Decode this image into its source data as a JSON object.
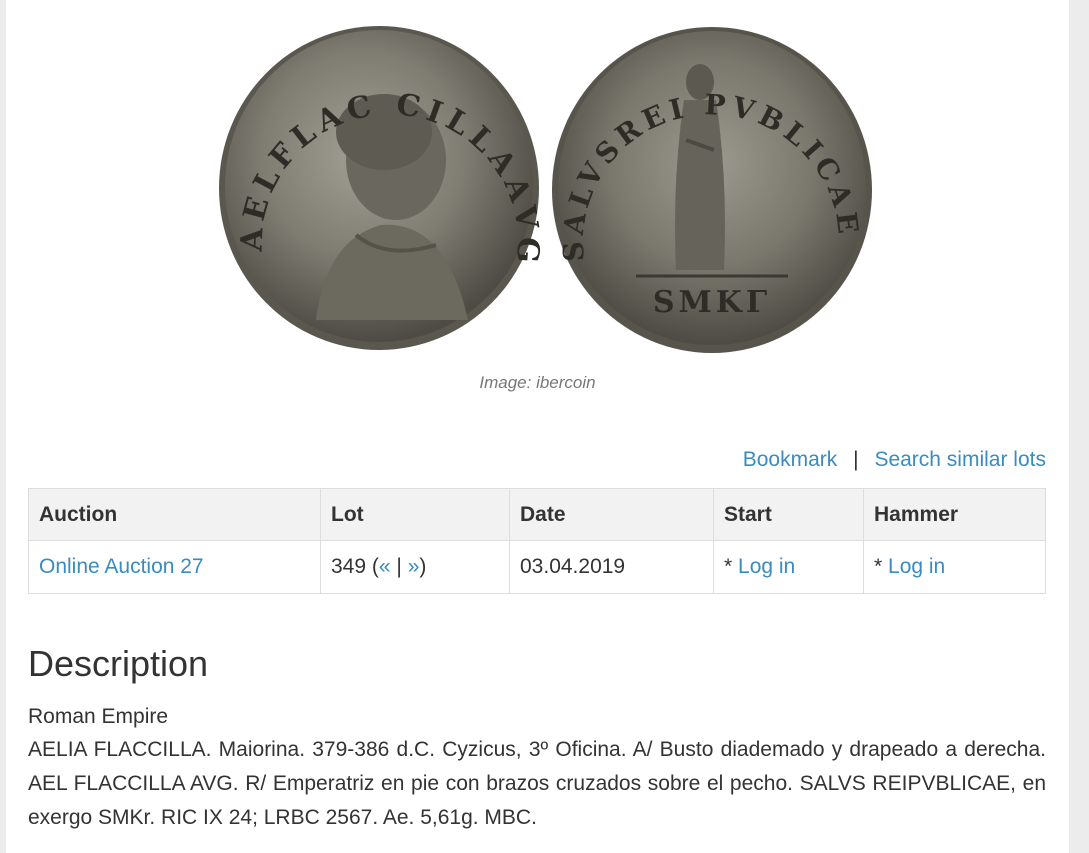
{
  "figure": {
    "alt": "Coin obverse and reverse",
    "credit": "Image: ibercoin",
    "obverse_legend": "AELFLAC CILLAAVG",
    "reverse_legend": "SALVSREI PVBLICAE",
    "exergue": "SMKΓ"
  },
  "actions": {
    "bookmark": "Bookmark",
    "separator": "|",
    "search_similar": "Search similar lots"
  },
  "table": {
    "headers": {
      "auction": "Auction",
      "lot": "Lot",
      "date": "Date",
      "start": "Start",
      "hammer": "Hammer"
    },
    "row": {
      "auction": "Online Auction 27",
      "lot_number": "349",
      "lot_open": " (",
      "prev": "«",
      "nav_sep": " | ",
      "next": "»",
      "lot_close": ")",
      "date": "03.04.2019",
      "start_prefix": "* ",
      "start_login": "Log in",
      "hammer_prefix": "* ",
      "hammer_login": "Log in"
    }
  },
  "description": {
    "title": "Description",
    "category": "Roman Empire",
    "text": "AELIA FLACCILLA. Maiorina. 379-386 d.C. Cyzicus, 3º Oficina. A/ Busto diademado y drapeado a derecha. AEL FLACCILLA AVG. R/ Emperatriz en pie con brazos cruzados sobre el pecho. SALVS REIPVBLICAE, en exergo SMKr. RIC IX 24; LRBC 2567. Ae. 5,61g. MBC."
  },
  "colors": {
    "link": "#3a8bbf",
    "text": "#333333",
    "header_bg": "#f2f2f2",
    "coin": "#7f7c72"
  }
}
